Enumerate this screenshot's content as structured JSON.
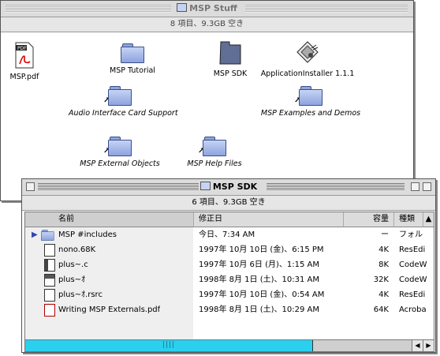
{
  "back_window": {
    "title": "MSP Stuff",
    "info": "8 項目、9.3GB 空き",
    "icons": [
      {
        "label": "MSP.pdf",
        "kind": "pdf-icon"
      },
      {
        "label": "MSP Tutorial",
        "kind": "folder-icon"
      },
      {
        "label": "MSP SDK",
        "kind": "folder-icon"
      },
      {
        "label": "ApplicationInstaller 1.1.1",
        "kind": "installer-icon"
      },
      {
        "label": "Audio Interface Card Support",
        "kind": "folder-alias-icon"
      },
      {
        "label": "MSP Examples and Demos",
        "kind": "folder-alias-icon"
      },
      {
        "label": "MSP External Objects",
        "kind": "folder-alias-icon"
      },
      {
        "label": "MSP Help Files",
        "kind": "folder-alias-icon"
      }
    ]
  },
  "front_window": {
    "title": "MSP SDK",
    "info": "6 項目、9.3GB 空き",
    "columns": {
      "name": "名前",
      "date": "修正日",
      "size": "容量",
      "kind": "種類"
    },
    "rows": [
      {
        "name": "MSP #includes",
        "date": "今日、7:34 AM",
        "size": "ー",
        "kind": "フォル",
        "icon": "folder-icon"
      },
      {
        "name": "nono.68K",
        "date": "1997年 10月 10日 (金)、6:15 PM",
        "size": "4K",
        "kind": "ResEdi",
        "icon": "resedit-file-icon"
      },
      {
        "name": "plus~.c",
        "date": "1997年 10月 6日 (月)、1:15 AM",
        "size": "8K",
        "kind": "CodeW",
        "icon": "codewarrior-file-icon"
      },
      {
        "name": "plus~ｵ",
        "date": "1998年 8月 1日 (土)、10:31 AM",
        "size": "32K",
        "kind": "CodeW",
        "icon": "codewarrior-project-icon"
      },
      {
        "name": "plus~ｵ.rsrc",
        "date": "1997年 10月 10日 (金)、0:54 AM",
        "size": "4K",
        "kind": "ResEdi",
        "icon": "resedit-file-icon"
      },
      {
        "name": "Writing MSP Externals.pdf",
        "date": "1998年 8月 1日 (土)、10:29 AM",
        "size": "64K",
        "kind": "Acroba",
        "icon": "pdf-icon"
      }
    ],
    "scrollbar": {
      "h_position": 0.0,
      "h_thumb_fraction": 0.76,
      "accent": "#2ad0ee"
    }
  },
  "colors": {
    "window_bg": "#ffffff",
    "header_bg": "#dcdcdc",
    "sort_col_bg": "#efefef"
  }
}
